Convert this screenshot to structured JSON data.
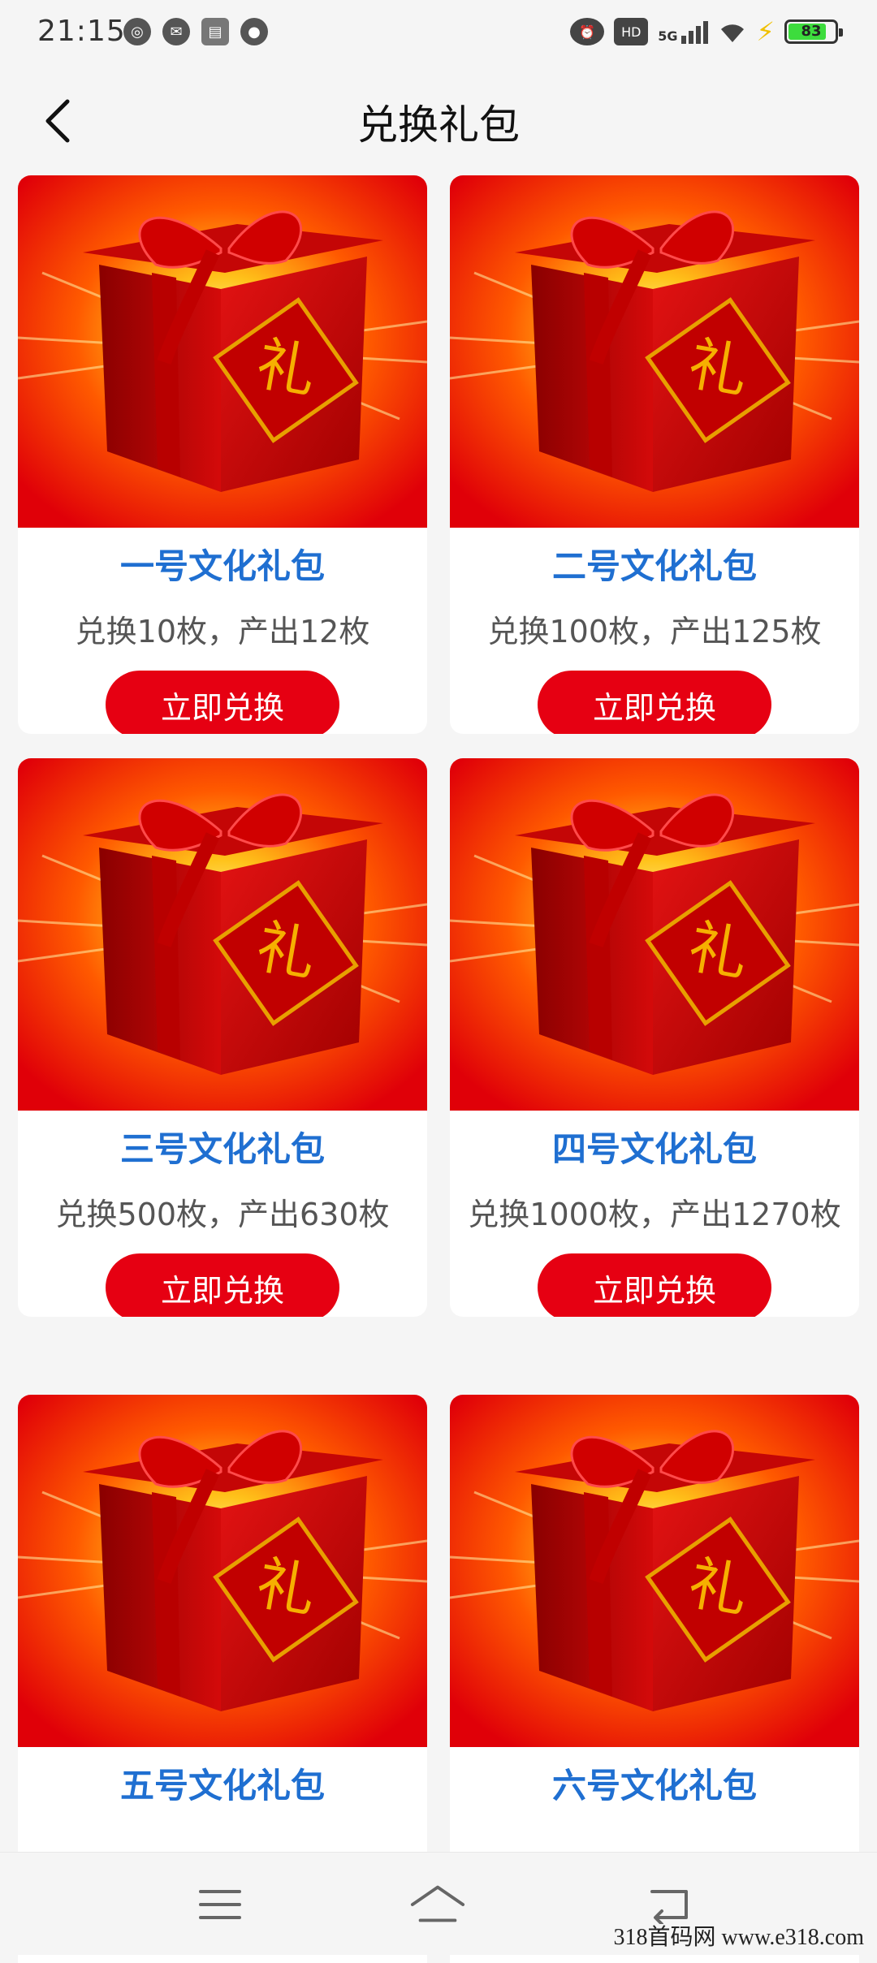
{
  "status_bar": {
    "time": "21:15",
    "network": "5G",
    "hd": "HD",
    "battery": "83",
    "battery_level": 0.83
  },
  "header": {
    "title": "兑换礼包"
  },
  "cards": [
    {
      "title": "一号文化礼包",
      "desc": "兑换10枚，产出12枚",
      "button": "立即兑换"
    },
    {
      "title": "二号文化礼包",
      "desc": "兑换100枚，产出125枚",
      "button": "立即兑换"
    },
    {
      "title": "三号文化礼包",
      "desc": "兑换500枚，产出630枚",
      "button": "立即兑换"
    },
    {
      "title": "四号文化礼包",
      "desc": "兑换1000枚，产出1270枚",
      "button": "立即兑换"
    },
    {
      "title": "五号文化礼包",
      "desc": "",
      "button": ""
    },
    {
      "title": "六号文化礼包",
      "desc": "",
      "button": ""
    }
  ],
  "gift_image": {
    "glyph": "礼"
  },
  "navbar": {
    "icons": [
      "menu-icon",
      "home-icon",
      "back-icon"
    ]
  },
  "watermark": "318首码网  www.e318.com",
  "colors": {
    "accent": "#e60012",
    "title_blue": "#1f6fd1",
    "background": "#f5f5f5"
  }
}
